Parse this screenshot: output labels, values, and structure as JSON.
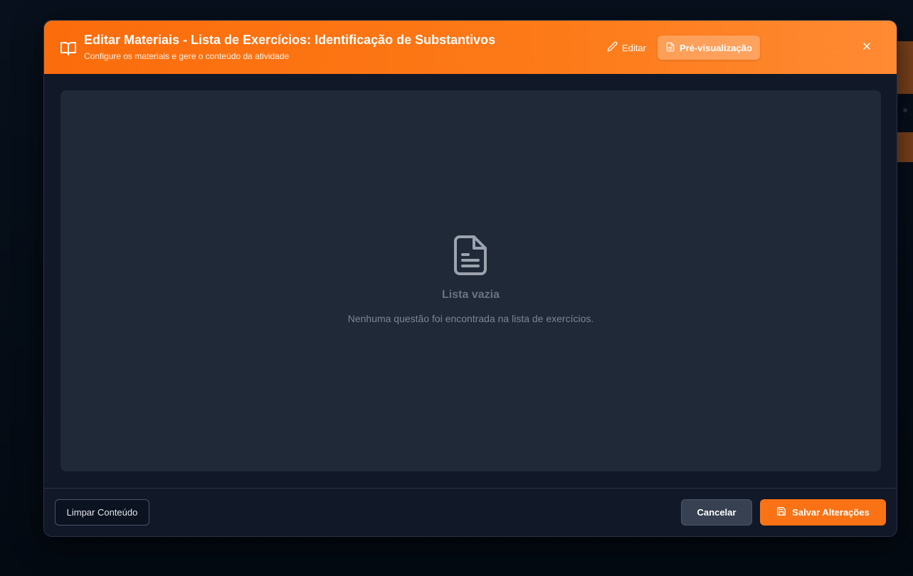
{
  "modal": {
    "title": "Editar Materiais - Lista de Exercícios: Identificação de Substantivos",
    "subtitle": "Configure os materiais e gere o conteúdo da atividade",
    "icons": {
      "header": "book-open-icon",
      "edit": "pencil-icon",
      "preview": "file-text-icon",
      "close": "close-icon",
      "empty": "file-text-icon",
      "save": "save-icon"
    },
    "modes": {
      "edit_label": "Editar",
      "preview_label": "Pré-visualização",
      "active": "preview"
    },
    "empty_state": {
      "title": "Lista vazia",
      "text": "Nenhuma questão foi encontrada na lista de exercícios."
    },
    "footer": {
      "clear_label": "Limpar Conteúdo",
      "cancel_label": "Cancelar",
      "save_label": "Salvar Alterações"
    }
  },
  "colors": {
    "accent": "#f97316",
    "header_gradient_start": "#fb6c0c",
    "header_gradient_end": "#ff8a33",
    "modal_bg": "#111827",
    "panel_bg": "#1f2937",
    "page_bg": "#050b14"
  }
}
